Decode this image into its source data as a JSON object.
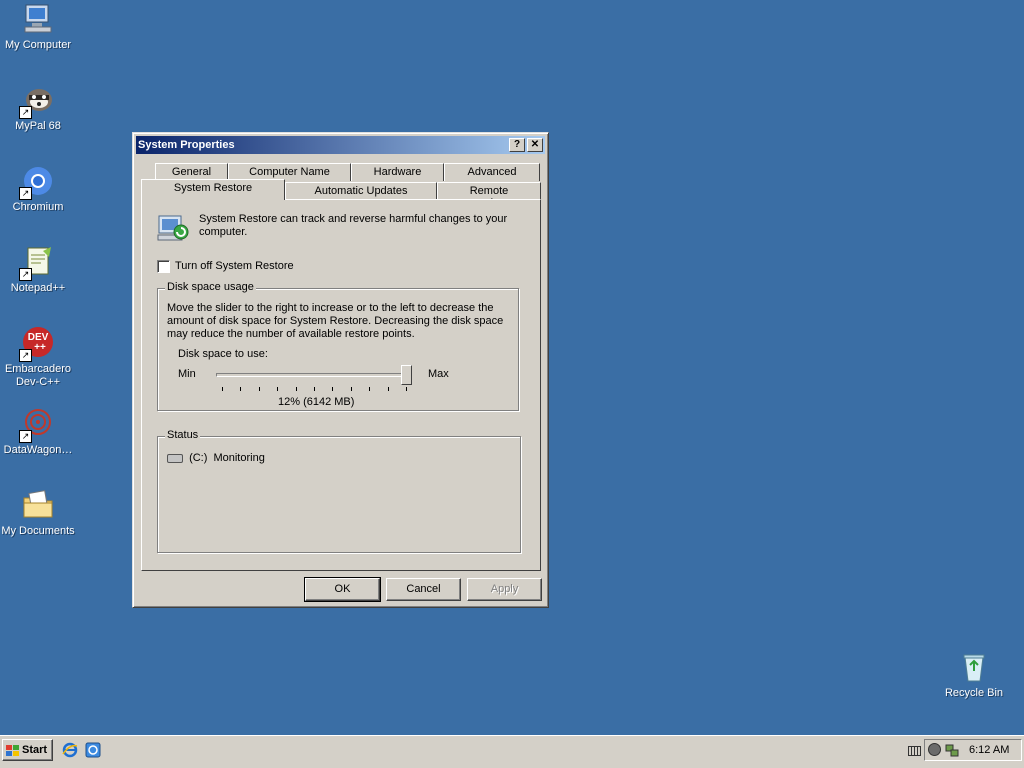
{
  "desktop": {
    "icons": [
      {
        "label": "My Computer",
        "icon": "my-computer-icon"
      },
      {
        "label": "MyPal 68",
        "icon": "mypal-icon"
      },
      {
        "label": "Chromium",
        "icon": "chromium-icon"
      },
      {
        "label": "Notepad++",
        "icon": "notepadpp-icon"
      },
      {
        "label": "Embarcadero Dev-C++",
        "icon": "devcpp-icon"
      },
      {
        "label": "DataWagon…",
        "icon": "datawagon-icon"
      },
      {
        "label": "My Documents",
        "icon": "my-documents-icon"
      },
      {
        "label": "Recycle Bin",
        "icon": "recycle-bin-icon"
      }
    ],
    "devcpp_logo_text": "DEV\n++"
  },
  "dialog": {
    "title": "System Properties",
    "help_glyph": "?",
    "close_glyph": "✕",
    "tabs_row1": [
      "General",
      "Computer Name",
      "Hardware",
      "Advanced"
    ],
    "tabs_row2": [
      "System Restore",
      "Automatic Updates",
      "Remote"
    ],
    "active_tab": "System Restore",
    "intro_text": "System Restore can track and reverse harmful changes to your computer.",
    "turn_off_label": "Turn off System Restore",
    "turn_off_checked": false,
    "disk_group": {
      "title": "Disk space usage",
      "description": "Move the slider to the right to increase or to the left to decrease the amount of disk space for System Restore. Decreasing the disk space may reduce the number of available restore points.",
      "slider_label": "Disk space to use:",
      "min_label": "Min",
      "max_label": "Max",
      "value_text": "12% (6142 MB)",
      "slider_fraction": 1.0
    },
    "status_group": {
      "title": "Status",
      "drive": "(C:)",
      "state": "Monitoring"
    },
    "buttons": {
      "ok": "OK",
      "cancel": "Cancel",
      "apply": "Apply"
    }
  },
  "taskbar": {
    "start_label": "Start",
    "clock": "6:12 AM",
    "quick_launch": [
      "internet-explorer-icon",
      "show-desktop-icon"
    ],
    "tray_icons": [
      "keyboard-icon",
      "volume-icon",
      "network-icon"
    ]
  }
}
